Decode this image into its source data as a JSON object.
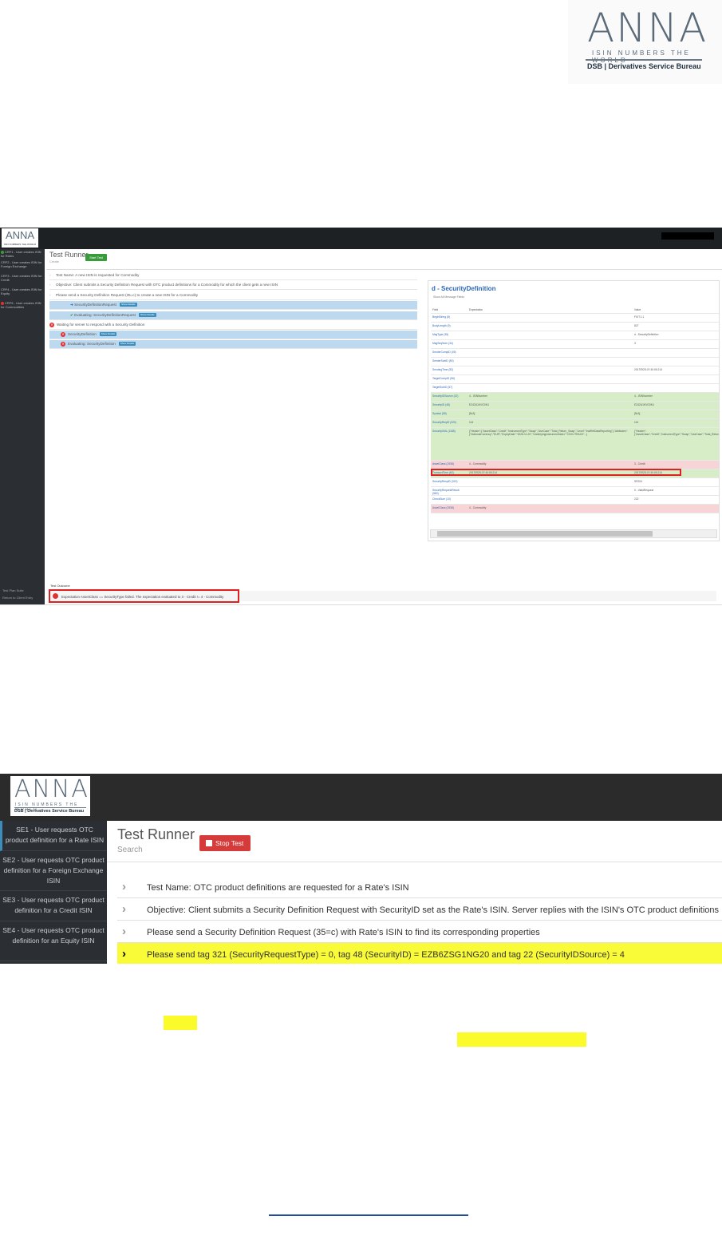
{
  "page_logo": {
    "wordmark": "ANNA",
    "tagline": "ISIN NUMBERS THE WORLD",
    "org": "DSB | Derivatives Service Bureau"
  },
  "screenshot1": {
    "logo_wordmark": "ANNA",
    "logo_tagline": "ISIN NUMBERS THE WORLD",
    "sidebar_items": [
      {
        "label": "CRF1 - User creates ISIN for Rates",
        "status": "ok"
      },
      {
        "label": "CRF2 - User creates ISIN for Foreign Exchange",
        "status": "none"
      },
      {
        "label": "CRF3 - User creates ISIN for Credit",
        "status": "none"
      },
      {
        "label": "CRF4 - User creates ISIN for Equity",
        "status": "none"
      },
      {
        "label": "CRF5 - User creates ISIN for Commodities",
        "status": "error"
      }
    ],
    "sidebar_bottom": [
      "Test Plan Suite",
      "Return to Client Entry"
    ],
    "title": "Test Runner",
    "subtitle": "Create",
    "start_button": "Start Test",
    "steps": [
      {
        "text": "Test Name: A new ISIN is requested for Commodity",
        "kind": "chevron",
        "badge": ""
      },
      {
        "text": "Objective: Client submits a Security Definition Request with OTC product definitions for a Commodity for which the client gets a new ISIN",
        "kind": "chevron",
        "badge": ""
      },
      {
        "text": "Please send a Security Definition Request (35=c) to create a new ISIN for a Commodity",
        "kind": "chevron",
        "badge": ""
      },
      {
        "text": "SecurityDefinitionRequest",
        "kind": "arrow",
        "badge": "Show Details"
      },
      {
        "text": "Evaluating: SecurityDefinitionRequest",
        "kind": "check",
        "badge": "Show Details"
      },
      {
        "text": "Waiting for server to respond with a Security Definition",
        "kind": "error",
        "badge": ""
      },
      {
        "text": "SecurityDefinition",
        "kind": "error-sub",
        "badge": "Show Details"
      },
      {
        "text": "Evaluating: SecurityDefinition",
        "kind": "error-sub",
        "badge": "Show Details"
      }
    ],
    "panel": {
      "title": "d - SecurityDefinition",
      "subtitle": "Show All Message Fields",
      "headers": [
        "Field",
        "Expectation",
        "Value"
      ],
      "rows": [
        {
          "field": "BeginString (8)",
          "exp": "",
          "val": "FIXT.1.1",
          "tone": ""
        },
        {
          "field": "BodyLength (9)",
          "exp": "",
          "val": "827",
          "tone": ""
        },
        {
          "field": "MsgType (35)",
          "exp": "",
          "val": "d - SecurityDefinition",
          "tone": ""
        },
        {
          "field": "MsgSeqNum (34)",
          "exp": "",
          "val": "3",
          "tone": ""
        },
        {
          "field": "SenderCompID (49)",
          "exp": "",
          "val": "",
          "tone": ""
        },
        {
          "field": "SenderSubID (50)",
          "exp": "",
          "val": "",
          "tone": ""
        },
        {
          "field": "SendingTime (52)",
          "exp": "",
          "val": "20170925-07:40:05.214",
          "tone": ""
        },
        {
          "field": "TargetCompID (56)",
          "exp": "",
          "val": "",
          "tone": ""
        },
        {
          "field": "TargetSubID (57)",
          "exp": "",
          "val": "",
          "tone": ""
        },
        {
          "field": "SecurityIDSource (22)",
          "exp": "4 - ISINNumber",
          "val": "4 - ISINNumber",
          "tone": "g"
        },
        {
          "field": "SecurityID (48)",
          "exp": "EZ42A1KVG0K4",
          "val": "EZ42A1KVG0K4",
          "tone": "g"
        },
        {
          "field": "Symbol (55)",
          "exp": "[N/A]",
          "val": "[N/A]",
          "tone": "g"
        },
        {
          "field": "SecurityReqID (320)",
          "exp": "114",
          "val": "114",
          "tone": "g"
        },
        {
          "field": "SecurityXML (1185)",
          "exp": "{\"Header\":{\"AssetClass\":\"Credit\",\"InstrumentType\":\"Swap\",\"UseCase\":\"Total_Return_Swap\",\"Level\":\"InstRefDataReporting\"},\"Attributes\":{\"NotionalCurrency\":\"EUR\",\"ExpiryDate\":\"2026-11-20\",\"UnderlyingInstrumentIndex\":\"CDX-ITRAXX\"...}",
          "val": "{\"Header\":{\"AssetClass\":\"Credit\",\"InstrumentType\":\"Swap\",\"UseCase\":\"Total_Return_Swap\"...}",
          "tone": "g tall"
        },
        {
          "field": "AssetClass (1938)",
          "exp": "4 - Commodity",
          "val": "3 - Credit",
          "tone": "p"
        },
        {
          "field": "TransactTime (60)",
          "exp": "20170925-07:40:05.214",
          "val": "20170925-07:40:05.214",
          "tone": "g"
        },
        {
          "field": "SecurityRespID (322)",
          "exp": "",
          "val": "SR224",
          "tone": ""
        },
        {
          "field": "SecurityRequestResult (560)",
          "exp": "",
          "val": "0 - ValidRequest",
          "tone": ""
        },
        {
          "field": "CheckSum (10)",
          "exp": "",
          "val": "222",
          "tone": ""
        },
        {
          "field": "AssetClass (1938)",
          "exp": "4 - Commodity",
          "val": "",
          "tone": "p"
        }
      ]
    },
    "outcome_label": "Test Outcome",
    "outcome_text": "Expectation AssetClass == SecurityType failed. The expectation evaluated to 3 - Credit != 4 - Commodity"
  },
  "screenshot2": {
    "logo_wordmark": "ANNA",
    "logo_tagline": "ISIN NUMBERS THE WORLD",
    "logo_org": "DSB | Derivatives Service Bureau",
    "sidebar_items": [
      "SE1 - User requests OTC product definition for a Rate ISIN",
      "SE2 - User requests OTC product definition for a Foreign Exchange ISIN",
      "SE3 - User requests OTC product definition for a Credit ISIN",
      "SE4 - User requests OTC product definition for an Equity ISIN"
    ],
    "title": "Test Runner",
    "subtitle": "Search",
    "stop_button": "Stop Test",
    "steps": [
      {
        "text": "Test Name: OTC product definitions are requested for a Rate's ISIN",
        "highlight": false
      },
      {
        "text": "Objective: Client submits a Security Definition Request with SecurityID set as the Rate's ISIN. Server replies with the ISIN's OTC product definitions",
        "highlight": false
      },
      {
        "text": "Please send a Security Definition Request (35=c) with Rate's ISIN to find its corresponding properties",
        "highlight": false
      },
      {
        "text": "Please send tag 321 (SecurityRequestType) = 0, tag 48 (SecurityID) = EZB6ZSG1NG20 and tag 22 (SecurityIDSource) = 4",
        "highlight": true
      }
    ]
  },
  "colors": {
    "highlight": "#fafb38",
    "error": "#e02020",
    "accent": "#3c8dbc"
  }
}
